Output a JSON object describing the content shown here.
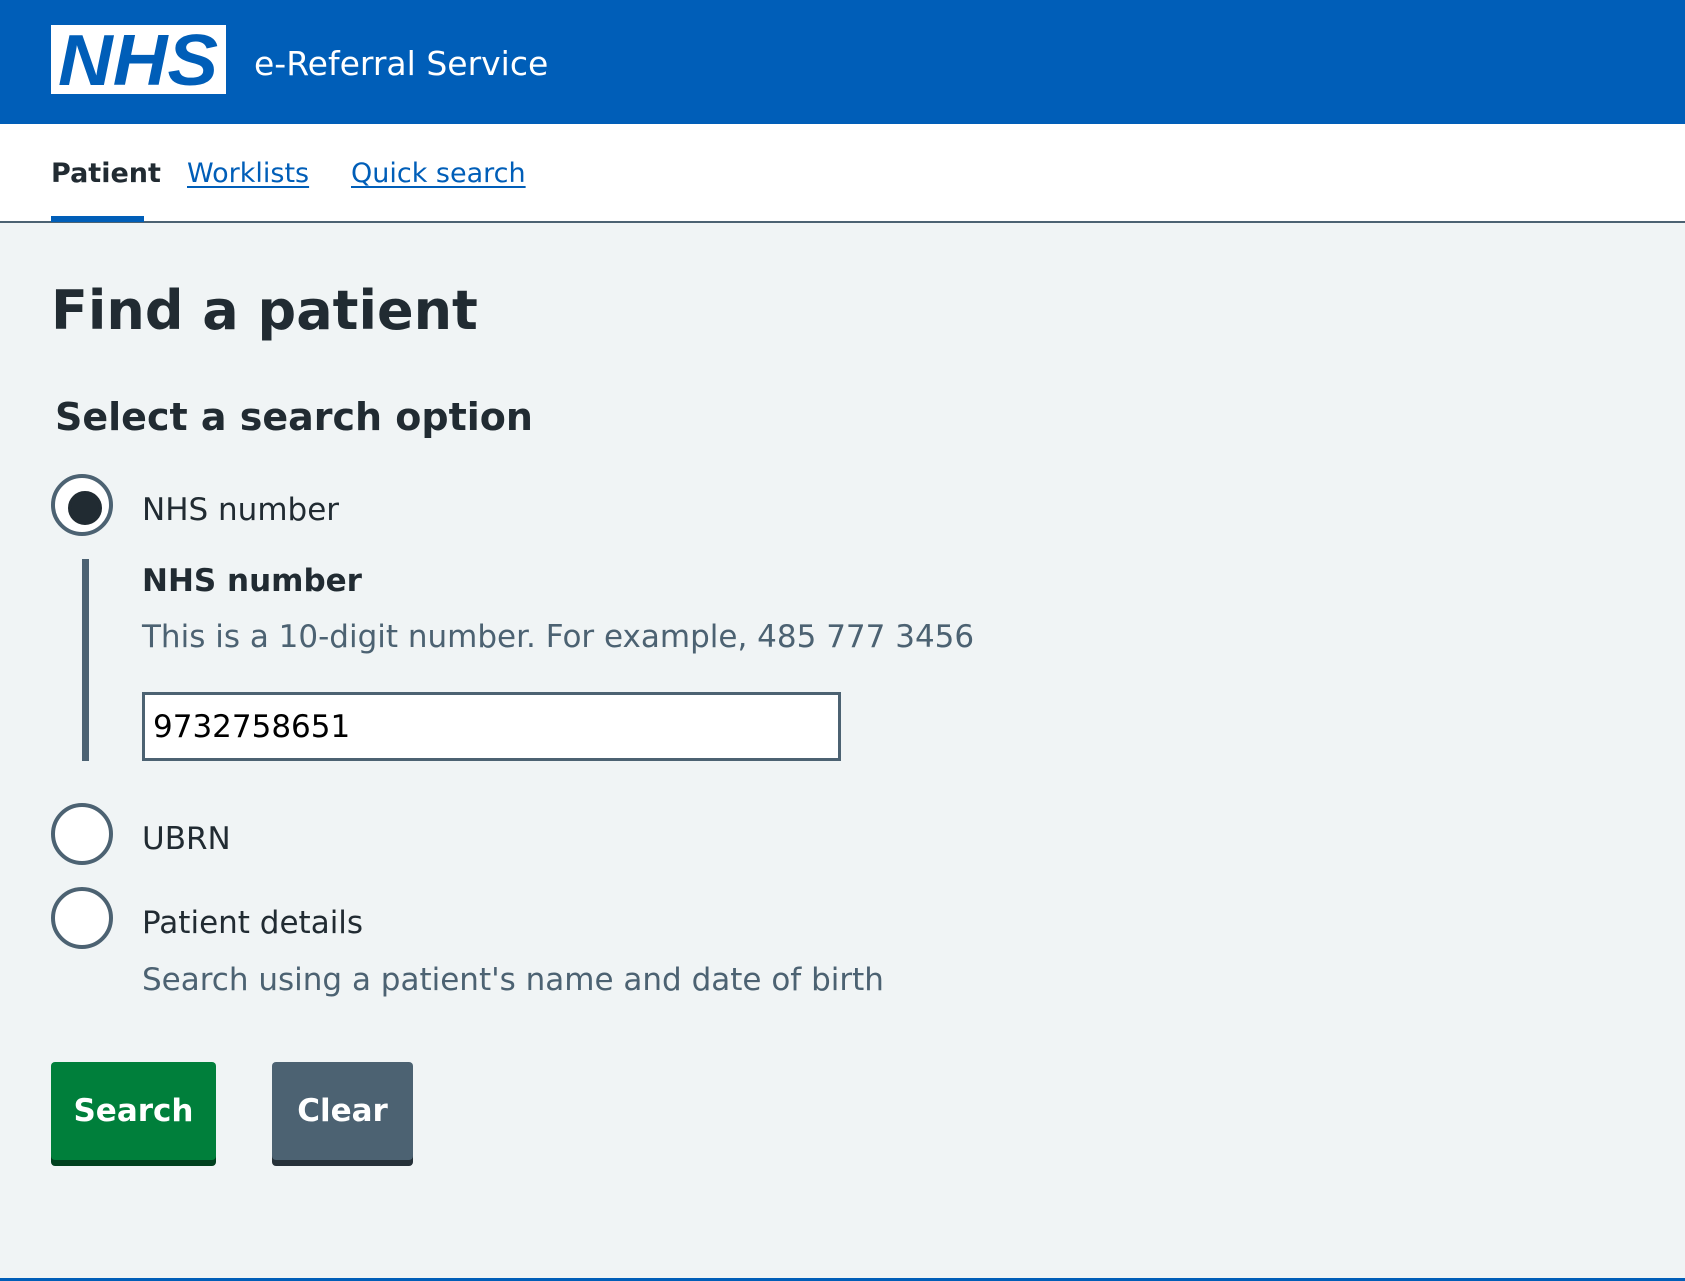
{
  "header": {
    "logo_text": "NHS",
    "service_name": "e-Referral Service"
  },
  "nav": {
    "items": [
      {
        "label": "Patient",
        "active": true
      },
      {
        "label": "Worklists",
        "active": false
      },
      {
        "label": "Quick search",
        "active": false
      }
    ]
  },
  "main": {
    "title": "Find a patient",
    "legend": "Select a search option",
    "options": [
      {
        "label": "NHS number",
        "selected": true
      },
      {
        "label": "UBRN",
        "selected": false
      },
      {
        "label": "Patient details",
        "selected": false,
        "hint": "Search using a patient's name and date of birth"
      }
    ],
    "nhs_number_field": {
      "label": "NHS number",
      "hint": "This is a 10-digit number. For example, 485 777 3456",
      "value": "9732758651"
    },
    "buttons": {
      "search": "Search",
      "clear": "Clear"
    }
  },
  "colors": {
    "brand_blue": "#005eb8",
    "background": "#f0f4f5",
    "button_green": "#007f3b",
    "button_grey": "#4c6272",
    "text": "#212b32"
  }
}
